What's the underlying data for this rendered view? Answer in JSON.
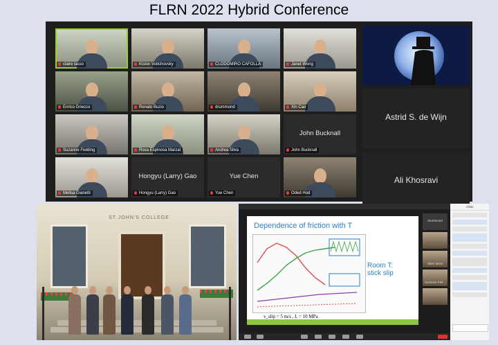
{
  "title": "FLRN 2022 Hybrid Conference",
  "zoom": {
    "participants": [
      {
        "name": "claire lasso",
        "video": true
      },
      {
        "name": "Kislon Voitchovsky",
        "video": true
      },
      {
        "name": "CLODOMIRO CAFOLLA",
        "video": true
      },
      {
        "name": "Janet Wong",
        "video": true
      },
      {
        "name": "Enrico Gnecco",
        "video": true
      },
      {
        "name": "Renato Buzio",
        "video": true
      },
      {
        "name": "drummond",
        "video": true
      },
      {
        "name": "Xin Cao",
        "video": true
      },
      {
        "name": "Suzanne Fielding",
        "video": true
      },
      {
        "name": "Rosa Espinosa Marzal",
        "video": true
      },
      {
        "name": "Andrea Silva",
        "video": true
      },
      {
        "name": "John Bucknall",
        "video": false,
        "center_label": "John Bucknall"
      },
      {
        "name": "Melisa Gianetti",
        "video": true
      },
      {
        "name": "Hongyu (Larry) Gao",
        "video": false,
        "center_label": "Hongyu (Larry) Gao"
      },
      {
        "name": "Yue Chen",
        "video": false,
        "center_label": "Yue Chen"
      },
      {
        "name": "Oded Hod",
        "video": true
      }
    ],
    "spotlight": [
      {
        "name": "",
        "type": "moon"
      },
      {
        "name": "Astrid S. de Wijn",
        "type": "name"
      },
      {
        "name": "Ali Khosravi",
        "type": "name"
      }
    ]
  },
  "photo": {
    "sign": "ST JOHN'S COLLEGE"
  },
  "share": {
    "slide_title": "Dependence of friction with T",
    "slide_label_line1": "Room T:",
    "slide_label_line2": "stick slip",
    "slide_footer": "v_slip = 5 m/s , L = 10 MPa",
    "thumbs": [
      "drummond",
      "",
      "claire lasso",
      "Suzanne Fiel...",
      ""
    ],
    "chat_header": "Chat",
    "colors": {
      "accent": "#2a7fc4",
      "band": "#8dc63f"
    }
  }
}
